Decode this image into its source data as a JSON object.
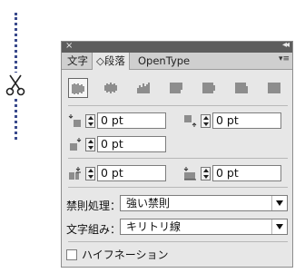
{
  "panel": {
    "tabs": [
      {
        "label": "文字"
      },
      {
        "label": "◇段落"
      },
      {
        "label": "OpenType"
      }
    ],
    "close_glyph": "×",
    "collapse_glyph": "◂◂",
    "menu_glyph": "▾≡"
  },
  "indents": {
    "left_indent": "0 pt",
    "right_indent": "0 pt",
    "first_line_indent": "0 pt",
    "space_before": "0 pt",
    "space_after": "0 pt"
  },
  "kinsoku": {
    "label": "禁則処理：",
    "value": "強い禁則"
  },
  "mojikumi": {
    "label": "文字組み：",
    "value": "キリトリ線"
  },
  "hyphenation": {
    "label": "ハイフネーション",
    "checked": false
  },
  "icons": [
    "scissors-icon",
    "align-left-icon",
    "align-center-icon",
    "align-right-icon",
    "justify-left-icon",
    "justify-center-icon",
    "justify-right-icon",
    "justify-all-icon"
  ]
}
